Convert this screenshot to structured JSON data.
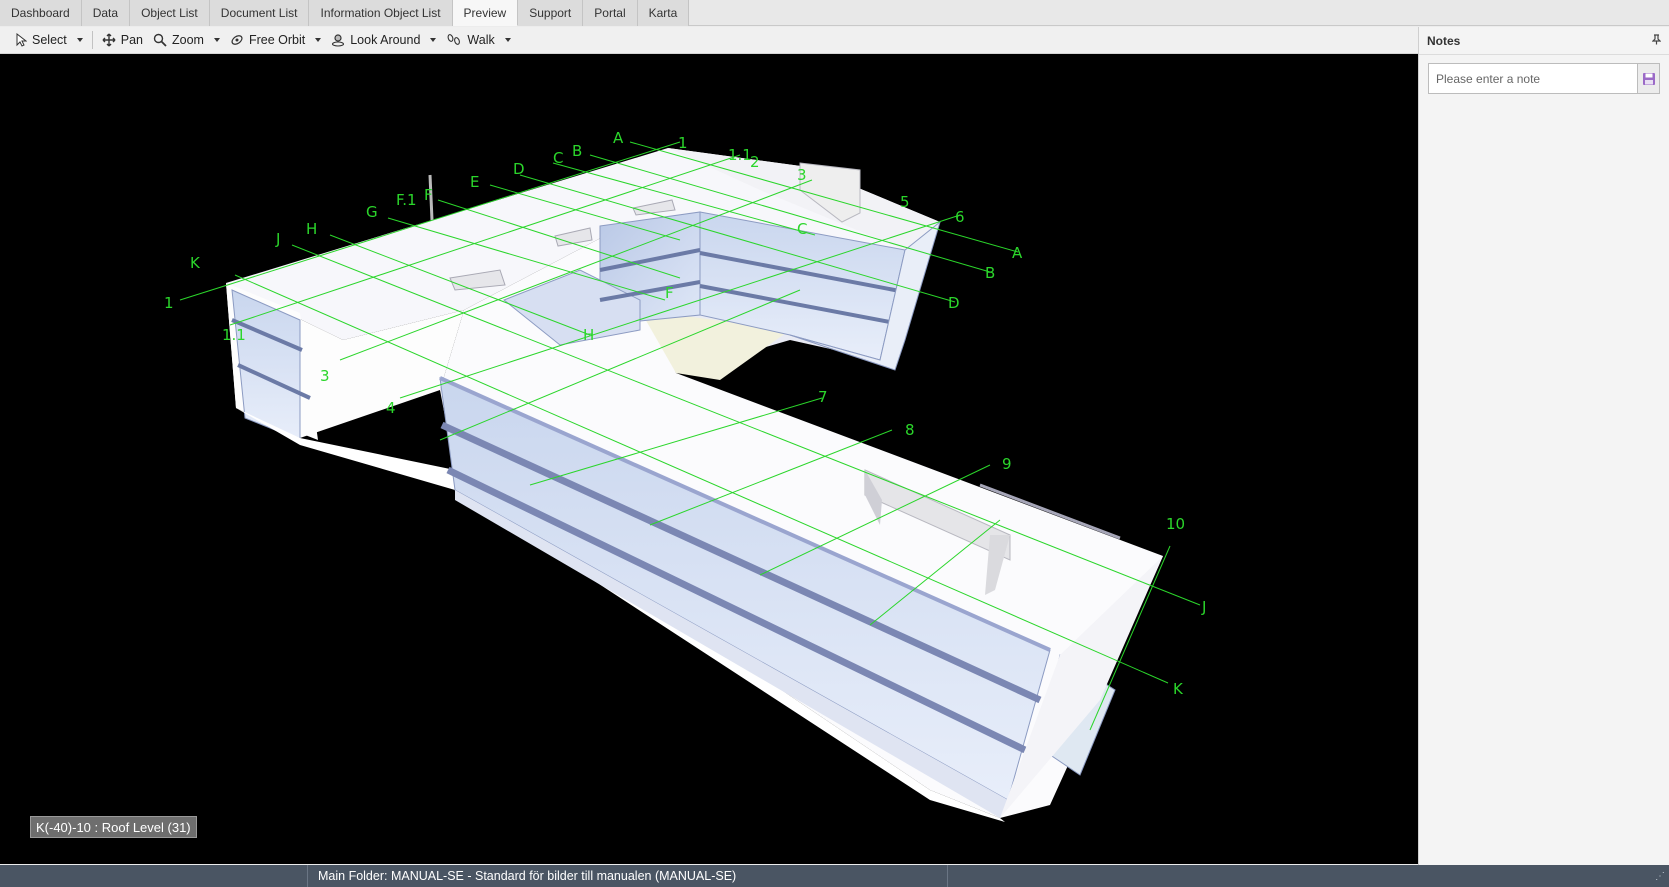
{
  "tabs": [
    {
      "label": "Dashboard"
    },
    {
      "label": "Data"
    },
    {
      "label": "Object List"
    },
    {
      "label": "Document List"
    },
    {
      "label": "Information Object List"
    },
    {
      "label": "Preview",
      "active": true
    },
    {
      "label": "Support"
    },
    {
      "label": "Portal"
    },
    {
      "label": "Karta"
    }
  ],
  "toolbar": {
    "select": "Select",
    "pan": "Pan",
    "zoom": "Zoom",
    "free_orbit": "Free Orbit",
    "look_around": "Look Around",
    "walk": "Walk"
  },
  "viewport": {
    "level_badge": "K(-40)-10 : Roof Level (31)",
    "grid_labels": {
      "A": "A",
      "B": "B",
      "C": "C",
      "D": "D",
      "E": "E",
      "F1": "F.1",
      "F": "F",
      "G": "G",
      "H": "H",
      "J": "J",
      "K": "K",
      "n1": "1",
      "n11": "1.1",
      "n2": "2",
      "n3": "3",
      "n4": "4",
      "n5": "5",
      "n6": "6",
      "n7": "7",
      "n8": "8",
      "n9": "9",
      "n10": "10"
    },
    "grid_color": "#2bd62b"
  },
  "notes": {
    "title": "Notes",
    "placeholder": "Please enter a note"
  },
  "statusbar": {
    "text": "Main Folder: MANUAL-SE - Standard för bilder till manualen (MANUAL-SE)"
  }
}
